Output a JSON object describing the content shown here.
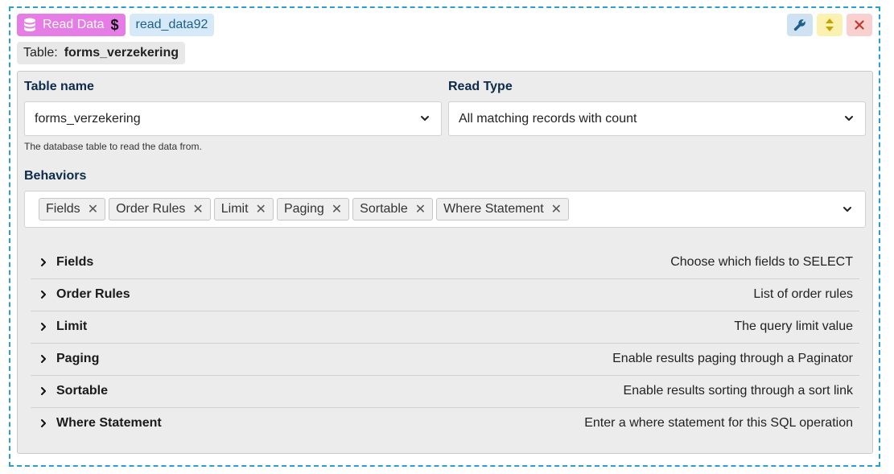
{
  "header": {
    "type_label": "Read Data",
    "name_label": "read_data92",
    "table_prefix": "Table:",
    "table_value": "forms_verzekering"
  },
  "tools": {
    "wrench_icon": "wrench-icon",
    "move_icon": "up-down-arrows-icon",
    "close_icon": "close-icon"
  },
  "fields": {
    "table_name": {
      "label": "Table name",
      "value": "forms_verzekering",
      "help": "The database table to read the data from."
    },
    "read_type": {
      "label": "Read Type",
      "value": "All matching records with count"
    },
    "behaviors": {
      "label": "Behaviors",
      "tags": [
        "Fields",
        "Order Rules",
        "Limit",
        "Paging",
        "Sortable",
        "Where Statement"
      ]
    }
  },
  "behavior_rows": [
    {
      "name": "Fields",
      "desc": "Choose which fields to SELECT"
    },
    {
      "name": "Order Rules",
      "desc": "List of order rules"
    },
    {
      "name": "Limit",
      "desc": "The query limit value"
    },
    {
      "name": "Paging",
      "desc": "Enable results paging through a Paginator"
    },
    {
      "name": "Sortable",
      "desc": "Enable results sorting through a sort link"
    },
    {
      "name": "Where Statement",
      "desc": "Enter a where statement for this SQL operation"
    }
  ],
  "colors": {
    "type_badge": "#e67de6",
    "name_badge": "#d6e9f8",
    "border_dashed": "#2a9fd6",
    "close_button": "#f8d0d0",
    "move_button": "#fbf1b0",
    "wrench_button": "#cfe2f3"
  }
}
